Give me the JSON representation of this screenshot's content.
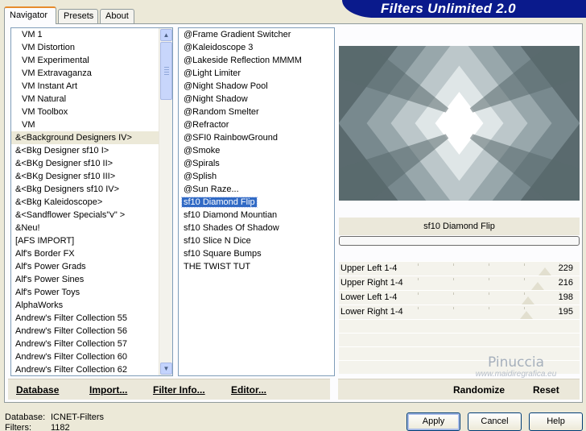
{
  "app": {
    "title": "Filters Unlimited 2.0"
  },
  "tabs": [
    {
      "label": "Navigator",
      "active": true
    },
    {
      "label": "Presets",
      "active": false
    },
    {
      "label": "About",
      "active": false
    }
  ],
  "categories": {
    "selected_index": 7,
    "items": [
      "VM 1",
      "VM Distortion",
      "VM Experimental",
      "VM Extravaganza",
      "VM Instant Art",
      "VM Natural",
      "VM Toolbox",
      "VM",
      "&<Background Designers IV>",
      "&<Bkg Designer sf10 I>",
      "&<BKg Designer sf10 II>",
      "&<BKg Designer sf10 III>",
      "&<Bkg Designers sf10 IV>",
      "&<Bkg Kaleidoscope>",
      "&<Sandflower Specials\"v\" >",
      "&Neu!",
      "[AFS IMPORT]",
      "Alf's Border FX",
      "Alf's Power Grads",
      "Alf's Power Sines",
      "Alf's Power Toys",
      "AlphaWorks",
      "Andrew's Filter Collection 55",
      "Andrew's Filter Collection 56",
      "Andrew's Filter Collection 57",
      "Andrew's Filter Collection 60",
      "Andrew's Filter Collection 62"
    ]
  },
  "filters": {
    "selected_index": 13,
    "items": [
      "@Frame Gradient Switcher",
      "@Kaleidoscope 3",
      "@Lakeside Reflection MMMM",
      "@Light Limiter",
      "@Night Shadow Pool",
      "@Night Shadow",
      "@Random Smelter",
      "@Refractor",
      "@SFI0 RainbowGround",
      "@Smoke",
      "@Spirals",
      "@Splish",
      "@Sun Raze...",
      "sf10 Diamond Flip",
      "sf10 Diamond Mountian",
      "sf10 Shades Of Shadow",
      "sf10 Slice N Dice",
      "sf10 Square Bumps",
      "THE TWIST TUT"
    ]
  },
  "preview": {
    "filter_name": "sf10 Diamond Flip",
    "colors": [
      "#5a6a6e",
      "#78898e",
      "#98a7ab",
      "#bcc7ca",
      "#dfe6e7",
      "#ffffff"
    ]
  },
  "sliders": [
    {
      "label": "Upper Left 1-4",
      "value": 229,
      "max": 255
    },
    {
      "label": "Upper Right 1-4",
      "value": 216,
      "max": 255
    },
    {
      "label": "Lower Left 1-4",
      "value": 198,
      "max": 255
    },
    {
      "label": "Lower Right 1-4",
      "value": 195,
      "max": 255
    }
  ],
  "watermark": {
    "line1": "Pinuccia",
    "line2": "www.maidiregrafica.eu"
  },
  "toolbar": {
    "database": "Database",
    "import": "Import...",
    "filter_info": "Filter Info...",
    "editor": "Editor...",
    "randomize": "Randomize",
    "reset": "Reset"
  },
  "footer": {
    "database_label": "Database:",
    "database_value": "ICNET-Filters",
    "filters_label": "Filters:",
    "filters_value": "1182"
  },
  "buttons": {
    "apply": "Apply",
    "cancel": "Cancel",
    "help": "Help"
  }
}
